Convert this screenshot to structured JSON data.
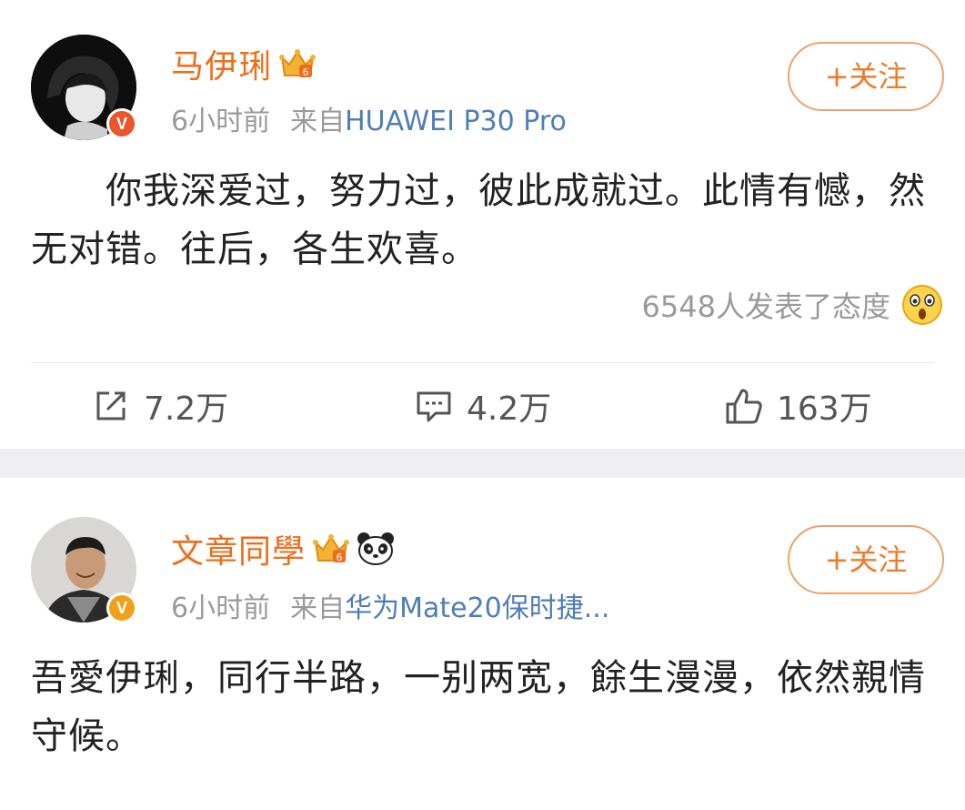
{
  "posts": [
    {
      "username": "马伊琍",
      "time": "6小时前",
      "source_prefix": "来自",
      "source": "HUAWEI P30 Pro",
      "follow_label": "+关注",
      "verified_badge": "V",
      "text": "你我深爱过，努力过，彼此成就过。此情有憾，然无对错。往后，各生欢喜。",
      "reactions_text": "6548人发表了态度",
      "reaction_icon": "surprised-face-icon",
      "actions": {
        "repost": "7.2万",
        "comment": "4.2万",
        "like": "163万"
      }
    },
    {
      "username": "文章同學",
      "time": "6小时前",
      "source_prefix": "来自",
      "source": "华为Mate20保时捷...",
      "follow_label": "+关注",
      "verified_badge": "V",
      "text": "吾愛伊琍，同行半路，一别两宽，餘生漫漫，依然親情守候。"
    }
  ],
  "colors": {
    "username": "#ef6d19",
    "follow_border": "#f0a16a",
    "source_link": "#4f7db8",
    "meta": "#9a9a9a",
    "separator": "#efeff1"
  },
  "icons": [
    "crown-member-icon",
    "panda-icon",
    "verified-icon",
    "repost-icon",
    "comment-icon",
    "like-icon"
  ]
}
